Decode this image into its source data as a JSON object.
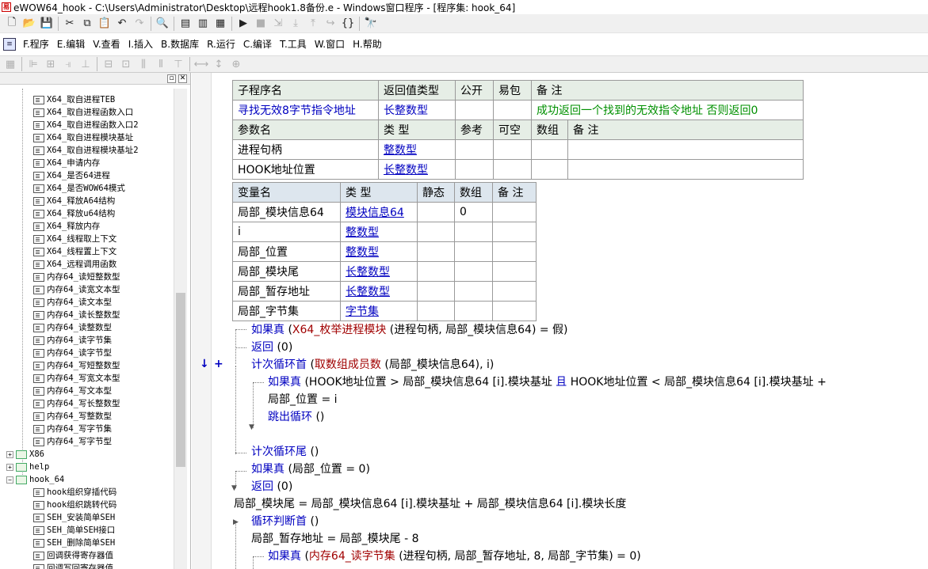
{
  "window": {
    "title": "eWOW64_hook - C:\\Users\\Administrator\\Desktop\\远程hook1.8备份.e - Windows窗口程序 - [程序集: hook_64]",
    "app_icon": "易"
  },
  "toolbar1": {
    "icons": [
      "new-file-icon",
      "open-folder-icon",
      "save-icon",
      "cut-icon",
      "copy-icon",
      "paste-icon",
      "undo-icon",
      "redo-icon",
      "preview-icon",
      "layout-1-icon",
      "layout-2-icon",
      "layout-3-icon",
      "run-icon",
      "stop-icon",
      "step-icon",
      "step-into-icon",
      "step-out-icon",
      "step-over-icon",
      "breakpoint-icon",
      "find-icon"
    ]
  },
  "menubar": {
    "items": [
      "F.程序",
      "E.编辑",
      "V.查看",
      "I.插入",
      "B.数据库",
      "R.运行",
      "C.编译",
      "T.工具",
      "W.窗口",
      "H.帮助"
    ]
  },
  "sidebar": {
    "items": [
      {
        "label": "X64_取自进程TEB",
        "type": "sub"
      },
      {
        "label": "X64_取自进程函数入口",
        "type": "sub"
      },
      {
        "label": "X64_取自进程函数入口2",
        "type": "sub"
      },
      {
        "label": "X64_取自进程模块基址",
        "type": "sub"
      },
      {
        "label": "X64_取自进程模块基址2",
        "type": "sub"
      },
      {
        "label": "X64_申请内存",
        "type": "sub"
      },
      {
        "label": "X64_是否64进程",
        "type": "sub"
      },
      {
        "label": "X64_是否WOW64模式",
        "type": "sub"
      },
      {
        "label": "X64_释放A64结构",
        "type": "sub"
      },
      {
        "label": "X64_释放u64结构",
        "type": "sub"
      },
      {
        "label": "X64_释放内存",
        "type": "sub"
      },
      {
        "label": "X64_线程取上下文",
        "type": "sub"
      },
      {
        "label": "X64_线程置上下文",
        "type": "sub"
      },
      {
        "label": "X64_远程调用函数",
        "type": "sub"
      },
      {
        "label": "内存64_读短整数型",
        "type": "sub"
      },
      {
        "label": "内存64_读宽文本型",
        "type": "sub"
      },
      {
        "label": "内存64_读文本型",
        "type": "sub"
      },
      {
        "label": "内存64_读长整数型",
        "type": "sub"
      },
      {
        "label": "内存64_读整数型",
        "type": "sub"
      },
      {
        "label": "内存64_读字节集",
        "type": "sub"
      },
      {
        "label": "内存64_读字节型",
        "type": "sub"
      },
      {
        "label": "内存64_写短整数型",
        "type": "sub"
      },
      {
        "label": "内存64_写宽文本型",
        "type": "sub"
      },
      {
        "label": "内存64_写文本型",
        "type": "sub"
      },
      {
        "label": "内存64_写长整数型",
        "type": "sub"
      },
      {
        "label": "内存64_写整数型",
        "type": "sub"
      },
      {
        "label": "内存64_写字节集",
        "type": "sub"
      },
      {
        "label": "内存64_写字节型",
        "type": "sub"
      },
      {
        "label": "X86",
        "type": "folder",
        "expand": "+"
      },
      {
        "label": "help",
        "type": "folder",
        "expand": "+"
      },
      {
        "label": "hook_64",
        "type": "folder",
        "expand": "−"
      },
      {
        "label": "hook组织穿插代码",
        "type": "sub"
      },
      {
        "label": "hook组织跳转代码",
        "type": "sub"
      },
      {
        "label": "SEH_安装简单SEH",
        "type": "sub"
      },
      {
        "label": "SEH_简单SEH接口",
        "type": "sub"
      },
      {
        "label": "SEH_删除简单SEH",
        "type": "sub"
      },
      {
        "label": "回调获得寄存器值",
        "type": "sub"
      },
      {
        "label": "回调写回寄存器值",
        "type": "sub"
      }
    ]
  },
  "sub_table": {
    "header": [
      "子程序名",
      "返回值类型",
      "公开",
      "易包",
      "备 注"
    ],
    "row": [
      "寻找无效8字节指令地址",
      "长整数型",
      "",
      "",
      "成功返回一个找到的无效指令地址   否则返回0"
    ],
    "param_header": [
      "参数名",
      "类 型",
      "参考",
      "可空",
      "数组",
      "备 注"
    ],
    "params": [
      [
        "进程句柄",
        "整数型",
        "",
        "",
        "",
        ""
      ],
      [
        "HOOK地址位置",
        "长整数型",
        "",
        "",
        "",
        ""
      ]
    ]
  },
  "var_table": {
    "header": [
      "变量名",
      "类 型",
      "静态",
      "数组",
      "备 注"
    ],
    "rows": [
      [
        "局部_模块信息64",
        "模块信息64",
        "",
        "0",
        ""
      ],
      [
        "i",
        "整数型",
        "",
        "",
        ""
      ],
      [
        "局部_位置",
        "整数型",
        "",
        "",
        ""
      ],
      [
        "局部_模块尾",
        "长整数型",
        "",
        "",
        ""
      ],
      [
        "局部_暂存地址",
        "长整数型",
        "",
        "",
        ""
      ],
      [
        "局部_字节集",
        "字节集",
        "",
        "",
        ""
      ]
    ]
  },
  "code": [
    {
      "a": "如果真",
      "b": " (",
      "c": "X64_枚举进程模块",
      "d": " (进程句柄, 局部_模块信息64) = 假)"
    },
    {
      "a": "返回",
      "b": " (0)",
      "c": "",
      "d": ""
    },
    {
      "a": "计次循环首",
      "b": " (",
      "c": "取数组成员数",
      "d": " (局部_模块信息64), i)"
    },
    {
      "a": "如果真",
      "b": " (HOOK地址位置 > 局部_模块信息64 [i].模块基址 ",
      "c": "且",
      "d": " HOOK地址位置 < 局部_模块信息64 [i].模块基址 +"
    },
    {
      "a": "",
      "b": "局部_位置 = i",
      "c": "",
      "d": ""
    },
    {
      "a": "跳出循环",
      "b": " ()",
      "c": "",
      "d": ""
    },
    {
      "a": "计次循环尾",
      "b": " ()",
      "c": "",
      "d": ""
    },
    {
      "a": "如果真",
      "b": " (局部_位置 = 0)",
      "c": "",
      "d": ""
    },
    {
      "a": "返回",
      "b": " (0)",
      "c": "",
      "d": ""
    },
    {
      "a": "",
      "b": "局部_模块尾 = 局部_模块信息64 [i].模块基址 + 局部_模块信息64 [i].模块长度",
      "c": "",
      "d": ""
    },
    {
      "a": "循环判断首",
      "b": " ()",
      "c": "",
      "d": ""
    },
    {
      "a": "",
      "b": "局部_暂存地址 = 局部_模块尾 - 8",
      "c": "",
      "d": ""
    },
    {
      "a": "如果真",
      "b": " (",
      "c": "内存64_读字节集",
      "d": " (进程句柄, 局部_暂存地址, 8, 局部_字节集) = 0)"
    }
  ],
  "gutter": {
    "mark1": "↓",
    "mark2": "+"
  }
}
